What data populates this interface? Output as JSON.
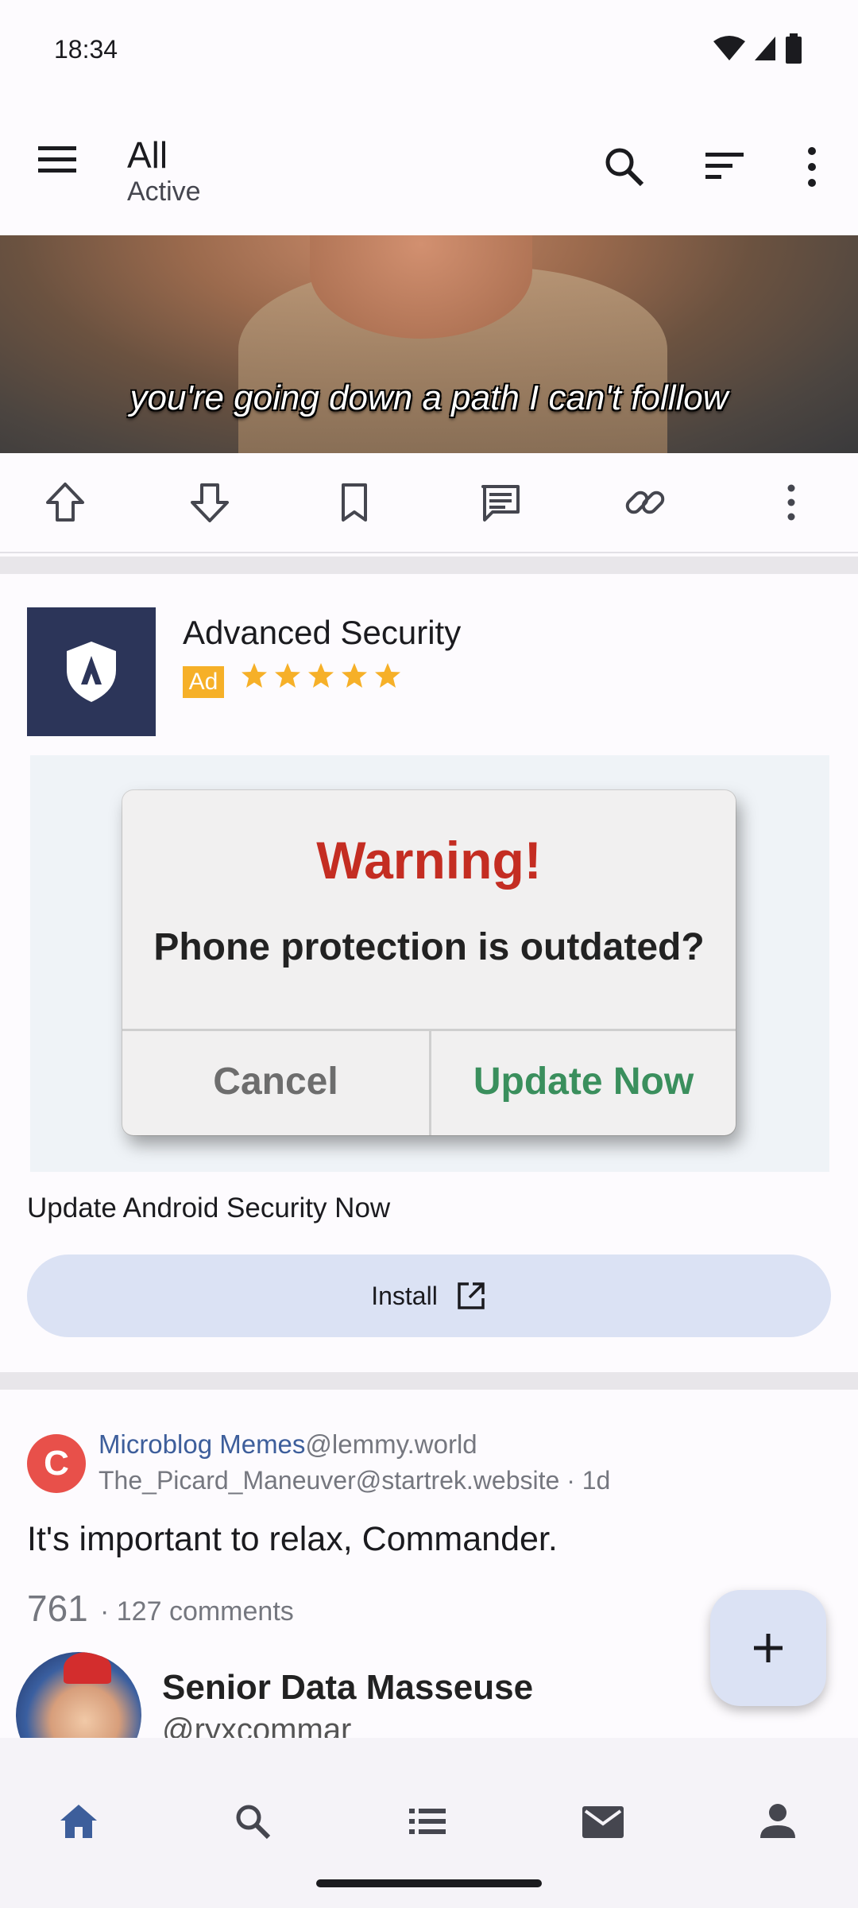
{
  "status_bar": {
    "time": "18:34"
  },
  "app_bar": {
    "title": "All",
    "subtitle": "Active"
  },
  "post1": {
    "image_caption": "you're going down a path I can't folllow"
  },
  "ad": {
    "title": "Advanced Security",
    "badge": "Ad",
    "rating_stars": 5,
    "dialog": {
      "title": "Warning!",
      "message": "Phone protection is outdated?",
      "cancel": "Cancel",
      "confirm": "Update Now"
    },
    "description": "Update Android Security Now",
    "install_label": "Install"
  },
  "post2": {
    "community_initial": "C",
    "community": "Microblog Memes",
    "instance": "@lemmy.world",
    "author_line": "The_Picard_Maneuver@startrek.website · 1d",
    "title": "It's important to relax, Commander.",
    "score": "761",
    "comments": "· 127 comments",
    "embed_name": "Senior Data Masseuse",
    "embed_handle": "@ryxcommar"
  },
  "colors": {
    "accent": "#3d5e9b",
    "warning_red": "#c42d22",
    "update_green": "#3a8f5d",
    "ad_badge": "#f6b028",
    "tonal_button": "#dbe2f4"
  },
  "icons": {
    "menu": "menu-icon",
    "search": "search-icon",
    "sort": "sort-icon",
    "more": "more-vert-icon",
    "upvote": "upvote-icon",
    "downvote": "downvote-icon",
    "save": "bookmark-icon",
    "comment": "comment-icon",
    "link": "link-icon",
    "nav": [
      "home-icon",
      "search-icon",
      "list-icon",
      "mail-icon",
      "person-icon"
    ]
  }
}
